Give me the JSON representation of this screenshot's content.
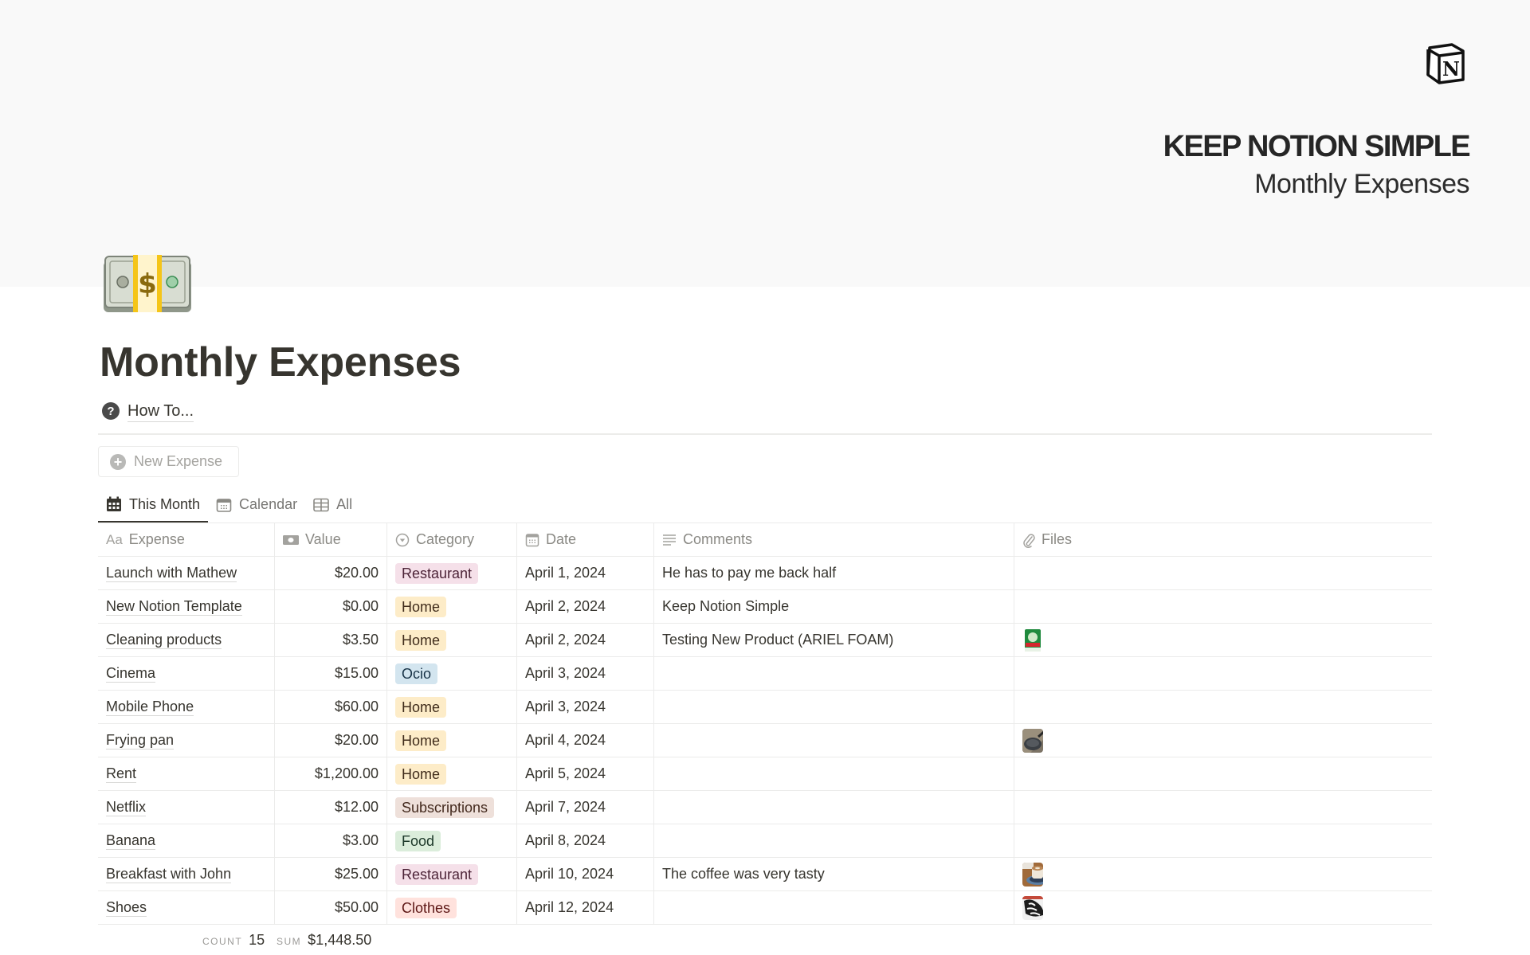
{
  "cover": {
    "brand_title": "KEEP NOTION SIMPLE",
    "brand_subtitle": "Monthly Expenses",
    "logo_icon": "notion-logo-icon"
  },
  "page": {
    "icon": "money-stack-emoji",
    "title": "Monthly Expenses",
    "howto_label": "How To...",
    "howto_icon": "question-circle-icon",
    "new_button_label": "New Expense"
  },
  "tabs": [
    {
      "label": "This Month",
      "icon": "calendar-filled-icon",
      "active": true
    },
    {
      "label": "Calendar",
      "icon": "calendar-icon",
      "active": false
    },
    {
      "label": "All",
      "icon": "table-icon",
      "active": false
    }
  ],
  "table": {
    "columns": [
      {
        "label": "Expense",
        "icon": "title-aa-icon"
      },
      {
        "label": "Value",
        "icon": "money-icon"
      },
      {
        "label": "Category",
        "icon": "select-icon"
      },
      {
        "label": "Date",
        "icon": "calendar-icon"
      },
      {
        "label": "Comments",
        "icon": "text-lines-icon"
      },
      {
        "label": "Files",
        "icon": "paperclip-icon"
      }
    ],
    "rows": [
      {
        "expense": "Launch with Mathew",
        "value": "$20.00",
        "category": "Restaurant",
        "date": "April 1, 2024",
        "comments": "He has to pay me back half",
        "file": ""
      },
      {
        "expense": "New Notion Template",
        "value": "$0.00",
        "category": "Home",
        "date": "April 2, 2024",
        "comments": "Keep Notion Simple",
        "file": ""
      },
      {
        "expense": "Cleaning products",
        "value": "$3.50",
        "category": "Home",
        "date": "April 2, 2024",
        "comments": "Testing New Product (ARIEL FOAM)",
        "file": "detergent-thumbnail"
      },
      {
        "expense": "Cinema",
        "value": "$15.00",
        "category": "Ocio",
        "date": "April 3, 2024",
        "comments": "",
        "file": ""
      },
      {
        "expense": "Mobile Phone",
        "value": "$60.00",
        "category": "Home",
        "date": "April 3, 2024",
        "comments": "",
        "file": ""
      },
      {
        "expense": "Frying pan",
        "value": "$20.00",
        "category": "Home",
        "date": "April 4, 2024",
        "comments": "",
        "file": "frying-pan-thumbnail"
      },
      {
        "expense": "Rent",
        "value": "$1,200.00",
        "category": "Home",
        "date": "April 5, 2024",
        "comments": "",
        "file": ""
      },
      {
        "expense": "Netflix",
        "value": "$12.00",
        "category": "Subscriptions",
        "date": "April 7, 2024",
        "comments": "",
        "file": ""
      },
      {
        "expense": "Banana",
        "value": "$3.00",
        "category": "Food",
        "date": "April 8, 2024",
        "comments": "",
        "file": ""
      },
      {
        "expense": "Breakfast with John",
        "value": "$25.00",
        "category": "Restaurant",
        "date": "April 10, 2024",
        "comments": "The coffee was very tasty",
        "file": "coffee-thumbnail"
      },
      {
        "expense": "Shoes",
        "value": "$50.00",
        "category": "Clothes",
        "date": "April 12, 2024",
        "comments": "",
        "file": "sneaker-thumbnail"
      }
    ],
    "footer": {
      "count_label": "COUNT",
      "count_value": "15",
      "sum_label": "SUM",
      "sum_value": "$1,448.50"
    }
  },
  "category_colors": {
    "Restaurant": {
      "bg": "#f5e0e9",
      "fg": "#4c2337"
    },
    "Home": {
      "bg": "#fdecc8",
      "fg": "#402c1b"
    },
    "Ocio": {
      "bg": "#d3e5ef",
      "fg": "#183347"
    },
    "Subscriptions": {
      "bg": "#eee0da",
      "fg": "#442a1e"
    },
    "Food": {
      "bg": "#dbeddb",
      "fg": "#1c3829"
    },
    "Clothes": {
      "bg": "#ffe2dd",
      "fg": "#5d1715"
    }
  }
}
